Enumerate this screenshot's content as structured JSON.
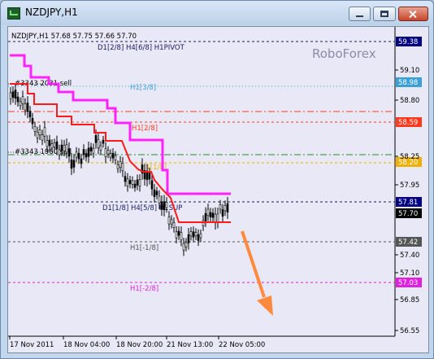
{
  "window": {
    "title": "NZDJPY,H1"
  },
  "chart": {
    "header": "NZDJPY,H1  57.68 57.75 57.66 57.70",
    "watermark": "RoboForex",
    "levels": [
      {
        "id": "pivot",
        "label": "D1[2/8] H4[6/8] H1PIVOT",
        "price": "59.38",
        "color": "#1a1a66",
        "badge_bg": "#000080",
        "style": "dashed"
      },
      {
        "id": "h1-3-8",
        "label": "H1[3/8]",
        "price": "58.98",
        "color": "#3aa0d8",
        "badge_bg": "#3aa0d8",
        "style": "dotted"
      },
      {
        "id": "unlabeled-red",
        "label": "",
        "price": "",
        "color": "#ff3b1f",
        "badge_bg": "",
        "style": "dashdot"
      },
      {
        "id": "h1-2-8",
        "label": "H1[2/8]",
        "price": "58.59",
        "color": "#ff3b1f",
        "badge_bg": "#ff3b1f",
        "style": "dashed"
      },
      {
        "id": "unlabeled-green",
        "label": "",
        "price": "",
        "color": "#2a8a2a",
        "badge_bg": "",
        "style": "dashdot"
      },
      {
        "id": "h1-1-8",
        "label": "H1[1/8]",
        "price": "58.20",
        "color": "#f0b000",
        "badge_bg": "#f0b000",
        "style": "dashed"
      },
      {
        "id": "sup",
        "label": "D1[1/8] H4[5/8] H1SUP",
        "price": "57.81",
        "color": "#1a1a66",
        "badge_bg": "#000080",
        "style": "dashed"
      },
      {
        "id": "current",
        "label": "",
        "price": "57.70",
        "color": "#000000",
        "badge_bg": "#000000",
        "style": "none"
      },
      {
        "id": "h1-m1-8",
        "label": "H1[-1/8]",
        "price": "57.42",
        "color": "#555555",
        "badge_bg": "#555555",
        "style": "dashed"
      },
      {
        "id": "h1-m2-8",
        "label": "H1[-2/8]",
        "price": "57.03",
        "color": "#e020e0",
        "badge_bg": "#e020e0",
        "style": "dashed"
      }
    ],
    "orders": [
      {
        "label": "#3343 2031 sell"
      },
      {
        "label": "#3343 1960 sell"
      }
    ],
    "y_axis_ticks": [
      "59.10",
      "58.80",
      "58.25",
      "57.95",
      "57.40",
      "57.10",
      "56.85",
      "56.55"
    ],
    "x_axis_ticks": [
      "17 Nov 2011",
      "18 Nov 04:00",
      "18 Nov 20:00",
      "21 Nov 13:00",
      "22 Nov 05:00"
    ]
  }
}
